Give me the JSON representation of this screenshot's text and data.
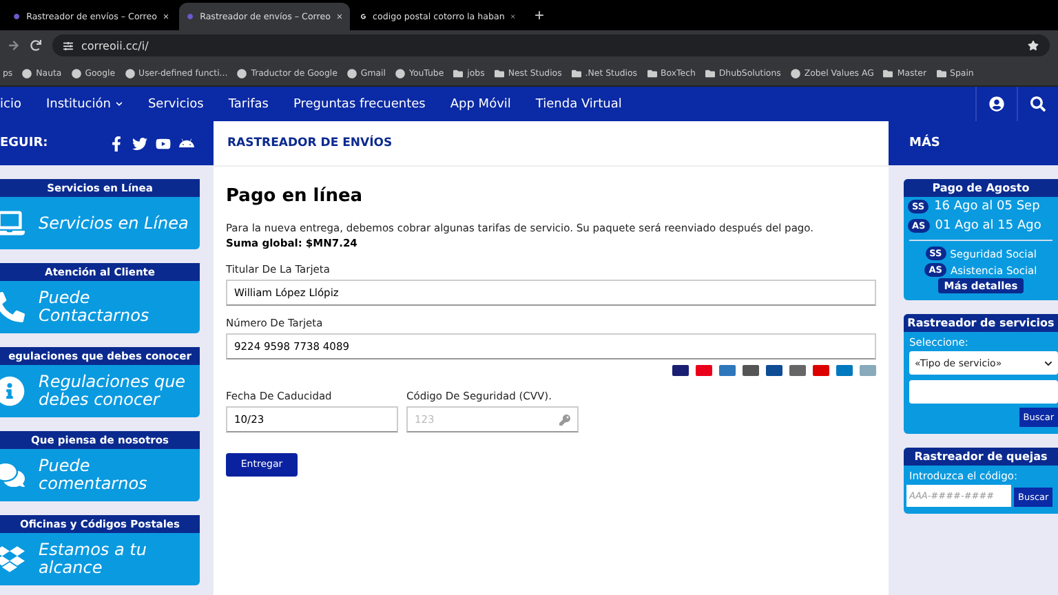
{
  "browser": {
    "tabs": [
      {
        "title": "Rastreador de envíos – Correo",
        "selected": false
      },
      {
        "title": "Rastreador de envíos – Correo",
        "selected": true
      },
      {
        "title": "codigo postal cotorro la haban",
        "selected": false
      }
    ],
    "new_tab": "+",
    "url": "correoii.cc/i/",
    "bookmarks": [
      {
        "label": "ps",
        "kind": "plain"
      },
      {
        "label": "Nauta",
        "kind": "site"
      },
      {
        "label": "Google",
        "kind": "site"
      },
      {
        "label": "User-defined functi...",
        "kind": "site"
      },
      {
        "label": "Traductor de Google",
        "kind": "site"
      },
      {
        "label": "Gmail",
        "kind": "site"
      },
      {
        "label": "YouTube",
        "kind": "site"
      },
      {
        "label": "jobs",
        "kind": "folder"
      },
      {
        "label": "Nest Studios",
        "kind": "folder"
      },
      {
        "label": ".Net Studios",
        "kind": "folder"
      },
      {
        "label": "BoxTech",
        "kind": "folder"
      },
      {
        "label": "DhubSolutions",
        "kind": "folder"
      },
      {
        "label": "Zobel Values AG",
        "kind": "site"
      },
      {
        "label": "Master",
        "kind": "folder"
      },
      {
        "label": "Spain",
        "kind": "folder"
      }
    ]
  },
  "nav": {
    "items": [
      {
        "label": "icio",
        "dropdown": false
      },
      {
        "label": "Institución",
        "dropdown": true
      },
      {
        "label": "Servicios",
        "dropdown": false
      },
      {
        "label": "Tarifas",
        "dropdown": false
      },
      {
        "label": "Preguntas frecuentes",
        "dropdown": false
      },
      {
        "label": "App Móvil",
        "dropdown": false
      },
      {
        "label": "Tienda Virtual",
        "dropdown": false
      }
    ]
  },
  "left": {
    "follow": "EGUIR:",
    "cards": [
      {
        "header": "Servicios en Línea",
        "text": "Servicios en Línea"
      },
      {
        "header": "Atención al Cliente",
        "text": "Puede Contactarnos"
      },
      {
        "header": "egulaciones que debes conocer",
        "text": "Regulaciones que debes conocer"
      },
      {
        "header": "Que piensa de nosotros",
        "text": "Puede comentarnos"
      },
      {
        "header": "Oficinas y Códigos Postales",
        "text": "Estamos a tu alcance"
      }
    ]
  },
  "main": {
    "section": "RASTREADOR DE ENVÍOS",
    "title": "Pago en línea",
    "intro": "Para la nueva entrega, debemos cobrar algunas tarifas de servicio. Su paquete será reenviado después del pago.",
    "total": "Suma global: $MN7.24",
    "holder": {
      "label": "Titular De La Tarjeta",
      "value": "William López Llópiz"
    },
    "number": {
      "label": "Número De Tarjeta",
      "value": "9224 9598 7738 4089"
    },
    "expiry": {
      "label": "Fecha De Caducidad",
      "value": "10/23"
    },
    "cvv": {
      "label": "Código De Seguridad (CVV).",
      "placeholder": "123"
    },
    "submit": "Entregar"
  },
  "right": {
    "section": "MÁS",
    "payment": {
      "header": "Pago de Agosto",
      "dates": [
        {
          "badge": "SS",
          "text": "16 Ago al 05 Sep"
        },
        {
          "badge": "AS",
          "text": "01 Ago al 15 Ago"
        }
      ],
      "legend": [
        {
          "badge": "SS",
          "text": "Seguridad Social"
        },
        {
          "badge": "AS",
          "text": "Asistencia Social"
        }
      ],
      "details": "Más detalles"
    },
    "services": {
      "header": "Rastreador de servicios",
      "label": "Seleccione:",
      "select": "«Tipo de servicio»",
      "button": "Buscar"
    },
    "complaints": {
      "header": "Rastreador de quejas",
      "label": "Introduzca el código:",
      "placeholder": "AAA-####-####",
      "button": "Buscar"
    }
  }
}
